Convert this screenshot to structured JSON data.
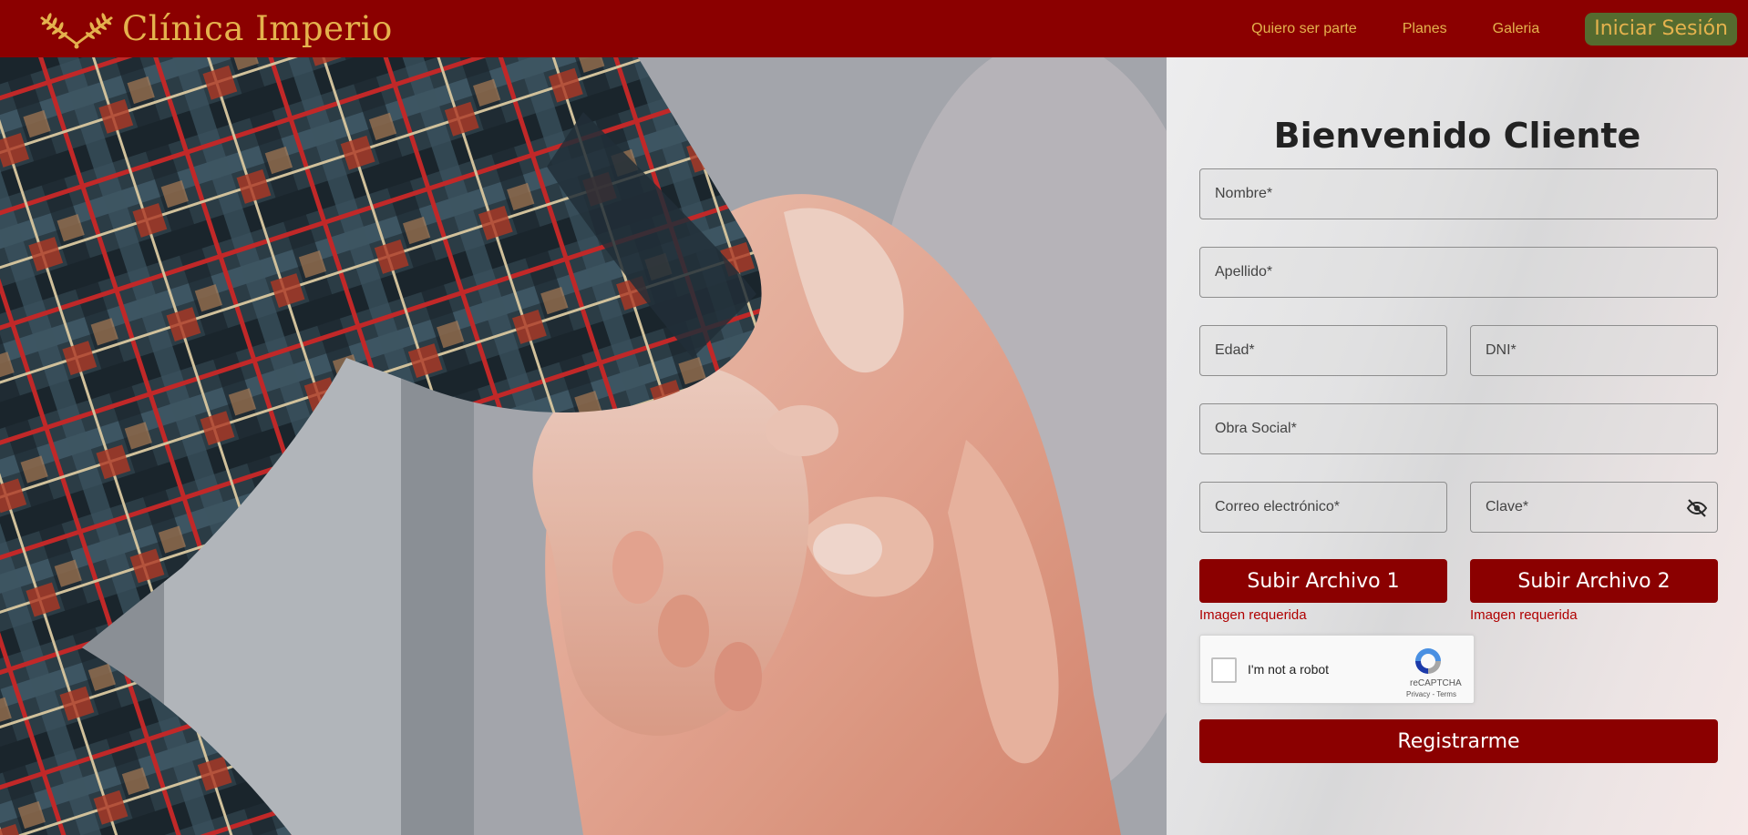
{
  "colors": {
    "navbar_bg": "#8b0000",
    "gold": "#e4b24d",
    "login_bg": "#556b2f",
    "primary_button": "#8b0000",
    "error_text": "#b00000"
  },
  "header": {
    "brand_name": "Clínica Imperio",
    "brand_icon": "laurel-wreath-icon",
    "nav": [
      {
        "label": "Quiero ser parte"
      },
      {
        "label": "Planes"
      },
      {
        "label": "Galeria"
      }
    ],
    "login_label": "Iniciar Sesión"
  },
  "form": {
    "title": "Bienvenido Cliente",
    "fields": {
      "nombre": {
        "placeholder": "Nombre*",
        "value": ""
      },
      "apellido": {
        "placeholder": "Apellido*",
        "value": ""
      },
      "edad": {
        "placeholder": "Edad*",
        "value": ""
      },
      "dni": {
        "placeholder": "DNI*",
        "value": ""
      },
      "obra_social": {
        "placeholder": "Obra Social*",
        "value": ""
      },
      "correo": {
        "placeholder": "Correo electrónico*",
        "value": ""
      },
      "clave": {
        "placeholder": "Clave*",
        "value": ""
      }
    },
    "password_toggle_icon": "eye-slash-icon",
    "upload1": {
      "label": "Subir Archivo 1",
      "error": "Imagen requerida"
    },
    "upload2": {
      "label": "Subir Archivo 2",
      "error": "Imagen requerida"
    },
    "captcha": {
      "label": "I'm not a robot",
      "brand": "reCAPTCHA",
      "terms": "Privacy - Terms",
      "icon": "recaptcha-icon"
    },
    "submit_label": "Registrarme"
  }
}
